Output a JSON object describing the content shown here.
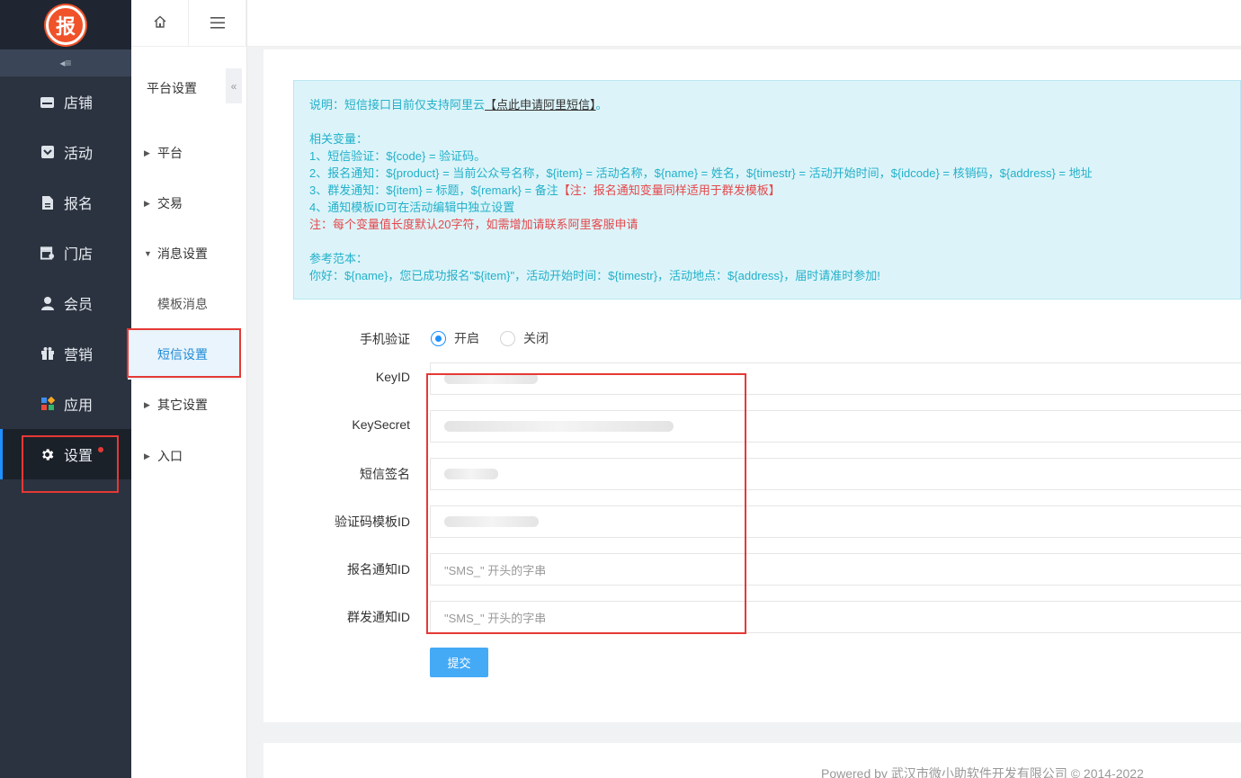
{
  "sidebar": {
    "logo_text": "报",
    "collapse_glyph": "◂≡",
    "items": [
      {
        "label": "店铺",
        "icon": "store-icon"
      },
      {
        "label": "活动",
        "icon": "activity-icon"
      },
      {
        "label": "报名",
        "icon": "document-icon"
      },
      {
        "label": "门店",
        "icon": "shop-icon"
      },
      {
        "label": "会员",
        "icon": "user-icon"
      },
      {
        "label": "营销",
        "icon": "gift-icon"
      },
      {
        "label": "应用",
        "icon": "apps-icon"
      },
      {
        "label": "设置",
        "icon": "gear-icon",
        "active": true
      }
    ]
  },
  "subnav": {
    "title": "平台设置",
    "fold_glyph": "«",
    "groups": [
      {
        "label": "平台",
        "arrow": "▶"
      },
      {
        "label": "交易",
        "arrow": "▶"
      },
      {
        "label": "消息设置",
        "arrow": "▼"
      },
      {
        "label": "其它设置",
        "arrow": "▶"
      },
      {
        "label": "入口",
        "arrow": "▶"
      }
    ],
    "children": [
      {
        "label": "模板消息"
      },
      {
        "label": "短信设置",
        "active": true
      }
    ]
  },
  "notice": {
    "intro_prefix": "说明：短信接口目前仅支持阿里云",
    "intro_link": "【点此申请阿里短信】",
    "intro_suffix": "。",
    "vars_title": "相关变量：",
    "var1": "1、短信验证：${code} = 验证码。",
    "var2": "2、报名通知：${product} = 当前公众号名称，${item} = 活动名称，${name} = 姓名，${timestr} = 活动开始时间，${idcode} = 核销码，${address} = 地址",
    "var3_main": "3、群发通知：${item} = 标题，${remark} = 备注",
    "var3_note": "【注：报名通知变量同样适用于群发模板】",
    "var4": "4、通知模板ID可在活动编辑中独立设置",
    "length_note": "注：每个变量值长度默认20字符，如需增加请联系阿里客服申请",
    "sample_title": "参考范本：",
    "sample": "你好：${name}，您已成功报名\"${item}\"，活动开始时间：${timestr}，活动地点：${address}，届时请准时参加!"
  },
  "form": {
    "phone_verify_label": "手机验证",
    "radio_on": "开启",
    "radio_off": "关闭",
    "keyid_label": "KeyID",
    "keysecret_label": "KeySecret",
    "sign_label": "短信签名",
    "verify_tpl_label": "验证码模板ID",
    "signup_tpl_label": "报名通知ID",
    "signup_tpl_placeholder": "\"SMS_\" 开头的字串",
    "group_tpl_label": "群发通知ID",
    "group_tpl_placeholder": "\"SMS_\" 开头的字串",
    "submit": "提交"
  },
  "footer": {
    "text": "Powered by 武汉市微小助软件开发有限公司 © 2014-2022"
  },
  "colors": {
    "sidebar_bg": "#2b3340",
    "accent": "#1e90ff",
    "notice_text": "#23b0ca",
    "highlight": "#e53935",
    "submit_bg": "#44aaf6"
  }
}
